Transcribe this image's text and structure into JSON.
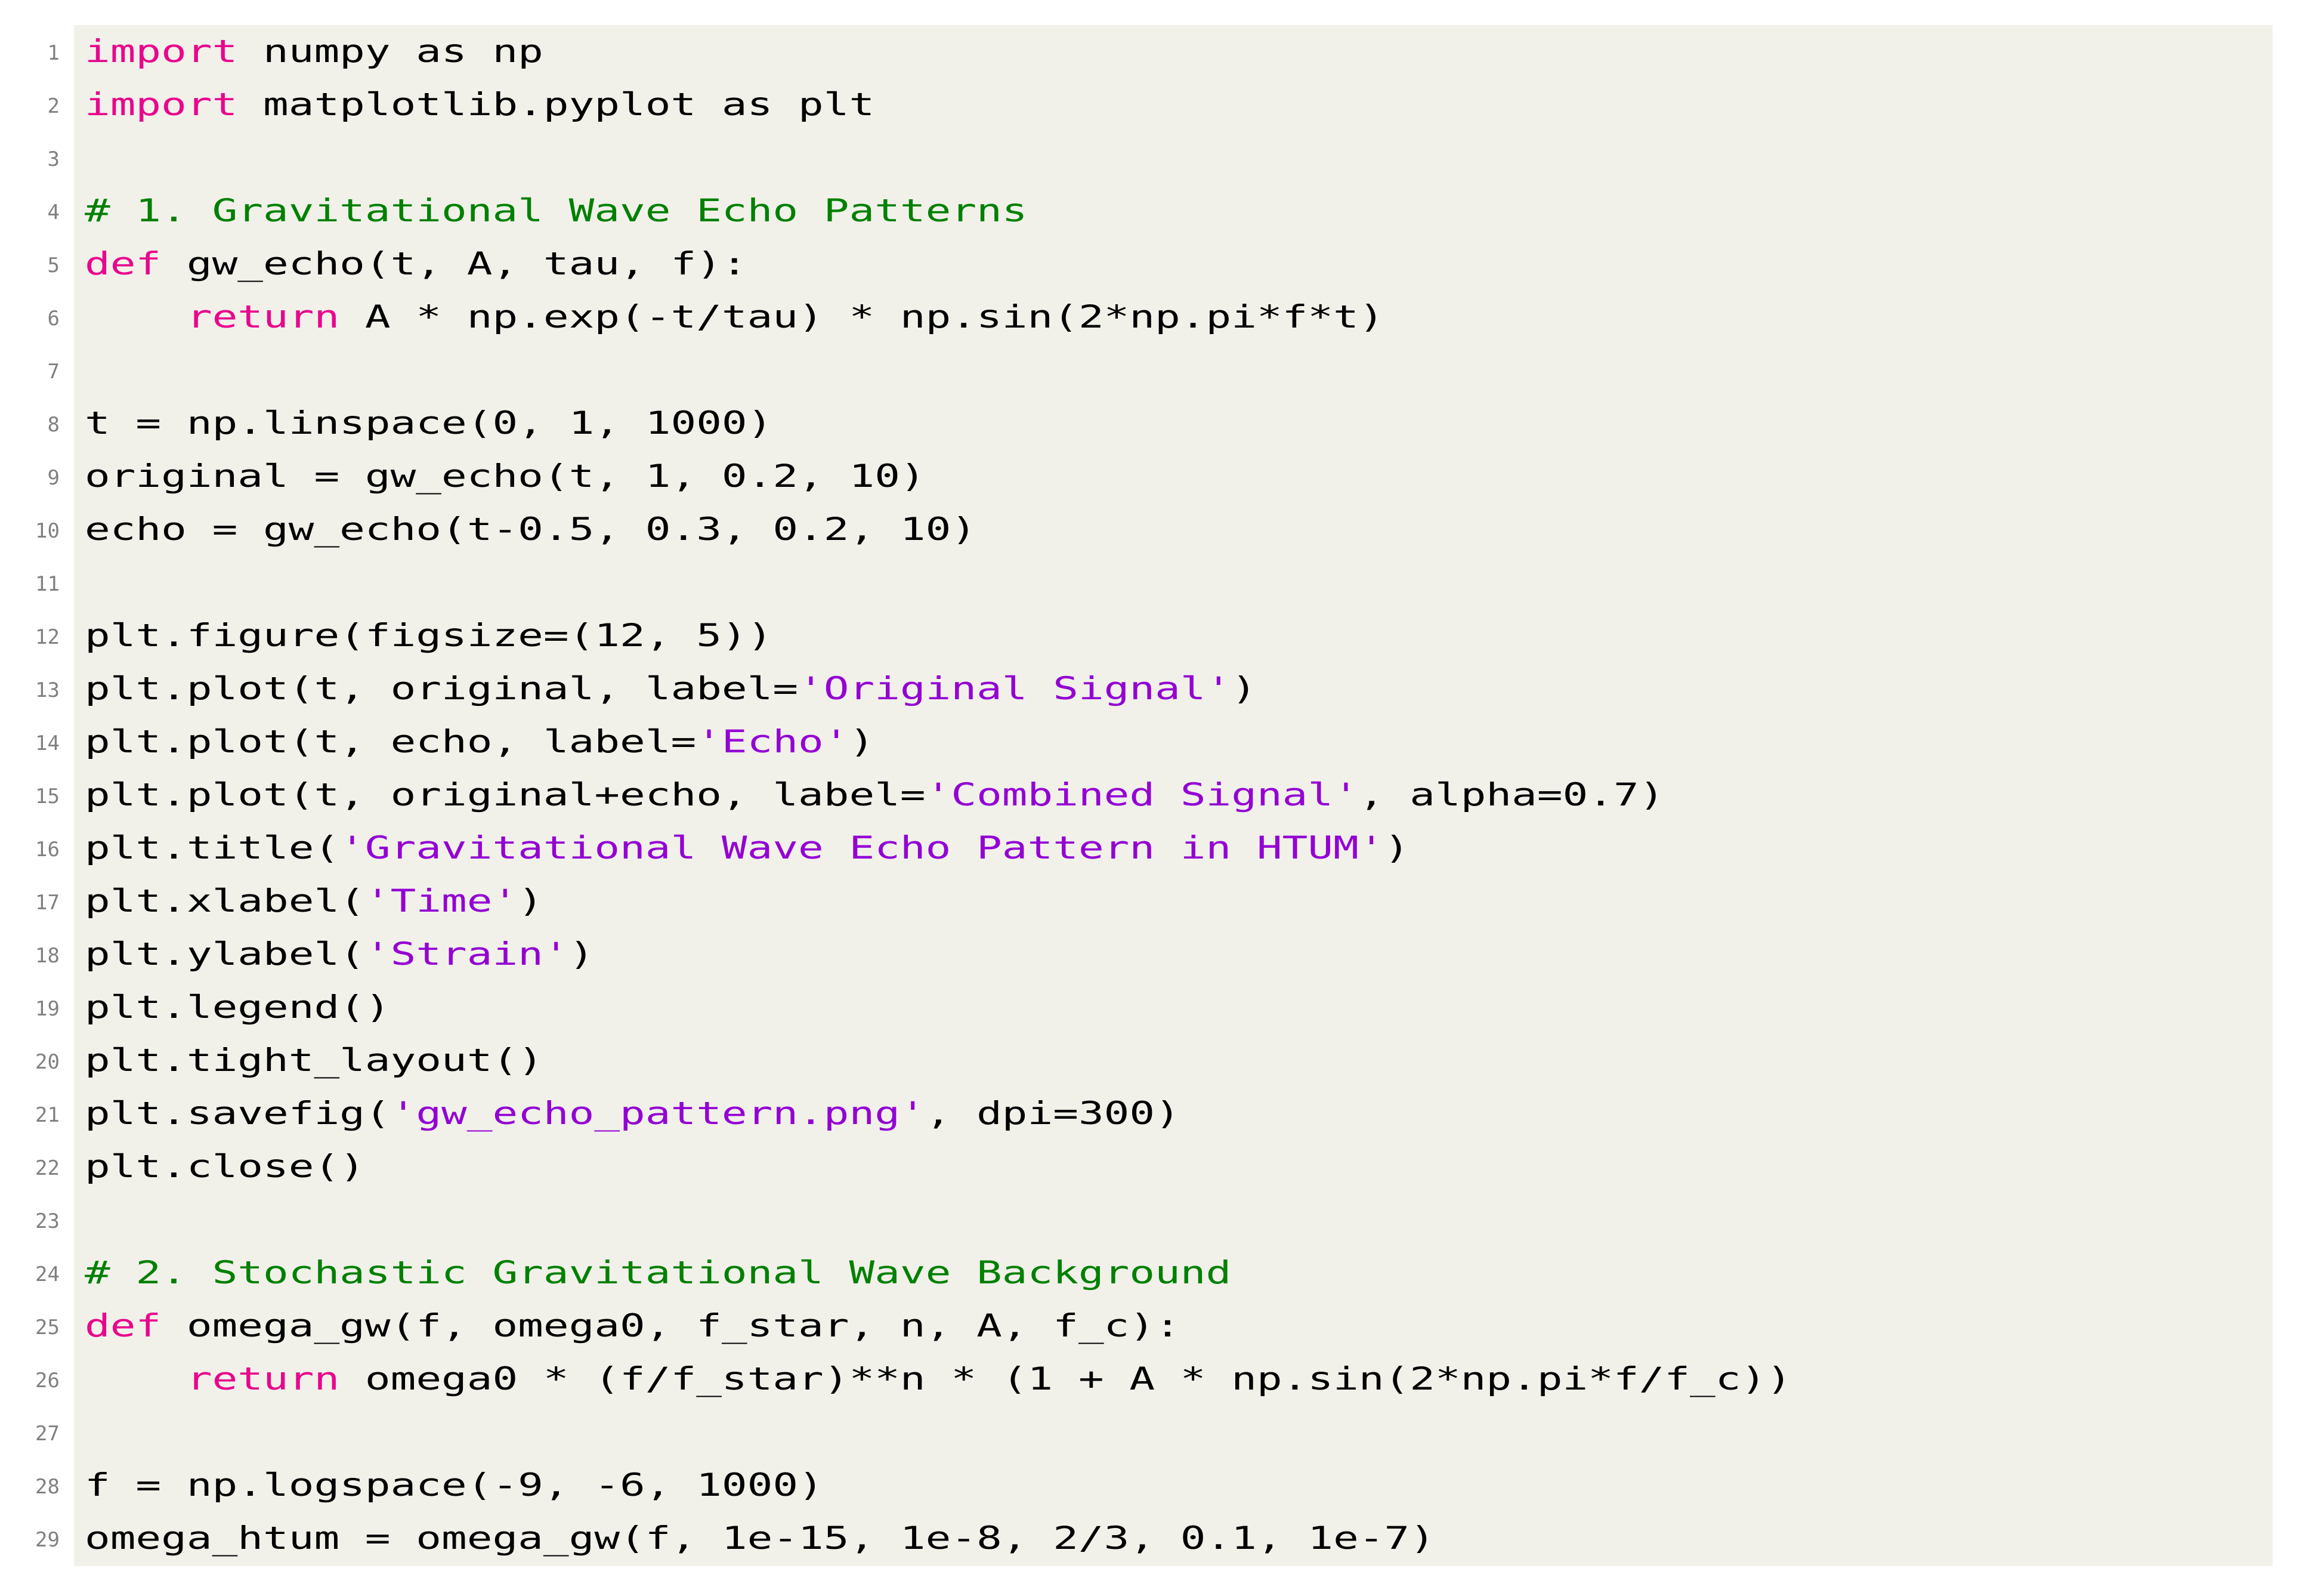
{
  "document": {
    "kind": "code-listing",
    "language": "Python",
    "line_count": 29
  },
  "colors": {
    "page_background": "#ffffff",
    "code_background": "#f1f1ea",
    "keyword": "#e8068c",
    "comment": "#008000",
    "string": "#9400d3",
    "plain_text": "#000000",
    "line_number": "#808080"
  },
  "code": {
    "lines": [
      {
        "number": "1",
        "text": "import numpy as np",
        "tokens": [
          {
            "t": "import",
            "c": "k"
          },
          {
            "t": " numpy as np",
            "c": "n"
          }
        ]
      },
      {
        "number": "2",
        "text": "import matplotlib.pyplot as plt",
        "tokens": [
          {
            "t": "import",
            "c": "k"
          },
          {
            "t": " matplotlib.pyplot as plt",
            "c": "n"
          }
        ]
      },
      {
        "number": "3",
        "text": "",
        "tokens": []
      },
      {
        "number": "4",
        "text": "# 1. Gravitational Wave Echo Patterns",
        "tokens": [
          {
            "t": "# 1. Gravitational Wave Echo Patterns",
            "c": "c"
          }
        ]
      },
      {
        "number": "5",
        "text": "def gw_echo(t, A, tau, f):",
        "tokens": [
          {
            "t": "def",
            "c": "k"
          },
          {
            "t": " gw_echo(t, A, tau, f):",
            "c": "n"
          }
        ]
      },
      {
        "number": "6",
        "text": "    return A * np.exp(-t/tau) * np.sin(2*np.pi*f*t)",
        "tokens": [
          {
            "t": "    ",
            "c": "n"
          },
          {
            "t": "return",
            "c": "k"
          },
          {
            "t": " A * np.exp(-t/tau) * np.sin(2*np.pi*f*t)",
            "c": "n"
          }
        ]
      },
      {
        "number": "7",
        "text": "",
        "tokens": []
      },
      {
        "number": "8",
        "text": "t = np.linspace(0, 1, 1000)",
        "tokens": [
          {
            "t": "t = np.linspace(0, 1, 1000)",
            "c": "n"
          }
        ]
      },
      {
        "number": "9",
        "text": "original = gw_echo(t, 1, 0.2, 10)",
        "tokens": [
          {
            "t": "original = gw_echo(t, 1, 0.2, 10)",
            "c": "n"
          }
        ]
      },
      {
        "number": "10",
        "text": "echo = gw_echo(t-0.5, 0.3, 0.2, 10)",
        "tokens": [
          {
            "t": "echo = gw_echo(t-0.5, 0.3, 0.2, 10)",
            "c": "n"
          }
        ]
      },
      {
        "number": "11",
        "text": "",
        "tokens": []
      },
      {
        "number": "12",
        "text": "plt.figure(figsize=(12, 5))",
        "tokens": [
          {
            "t": "plt.figure(figsize=(12, 5))",
            "c": "n"
          }
        ]
      },
      {
        "number": "13",
        "text": "plt.plot(t, original, label='Original Signal')",
        "tokens": [
          {
            "t": "plt.plot(t, original, label=",
            "c": "n"
          },
          {
            "t": "'Original Signal'",
            "c": "s"
          },
          {
            "t": ")",
            "c": "n"
          }
        ]
      },
      {
        "number": "14",
        "text": "plt.plot(t, echo, label='Echo')",
        "tokens": [
          {
            "t": "plt.plot(t, echo, label=",
            "c": "n"
          },
          {
            "t": "'Echo'",
            "c": "s"
          },
          {
            "t": ")",
            "c": "n"
          }
        ]
      },
      {
        "number": "15",
        "text": "plt.plot(t, original+echo, label='Combined Signal', alpha=0.7)",
        "tokens": [
          {
            "t": "plt.plot(t, original+echo, label=",
            "c": "n"
          },
          {
            "t": "'Combined Signal'",
            "c": "s"
          },
          {
            "t": ", alpha=0.7)",
            "c": "n"
          }
        ]
      },
      {
        "number": "16",
        "text": "plt.title('Gravitational Wave Echo Pattern in HTUM')",
        "tokens": [
          {
            "t": "plt.title(",
            "c": "n"
          },
          {
            "t": "'Gravitational Wave Echo Pattern in HTUM'",
            "c": "s"
          },
          {
            "t": ")",
            "c": "n"
          }
        ]
      },
      {
        "number": "17",
        "text": "plt.xlabel('Time')",
        "tokens": [
          {
            "t": "plt.xlabel(",
            "c": "n"
          },
          {
            "t": "'Time'",
            "c": "s"
          },
          {
            "t": ")",
            "c": "n"
          }
        ]
      },
      {
        "number": "18",
        "text": "plt.ylabel('Strain')",
        "tokens": [
          {
            "t": "plt.ylabel(",
            "c": "n"
          },
          {
            "t": "'Strain'",
            "c": "s"
          },
          {
            "t": ")",
            "c": "n"
          }
        ]
      },
      {
        "number": "19",
        "text": "plt.legend()",
        "tokens": [
          {
            "t": "plt.legend()",
            "c": "n"
          }
        ]
      },
      {
        "number": "20",
        "text": "plt.tight_layout()",
        "tokens": [
          {
            "t": "plt.tight_layout()",
            "c": "n"
          }
        ]
      },
      {
        "number": "21",
        "text": "plt.savefig('gw_echo_pattern.png', dpi=300)",
        "tokens": [
          {
            "t": "plt.savefig(",
            "c": "n"
          },
          {
            "t": "'gw_echo_pattern.png'",
            "c": "s"
          },
          {
            "t": ", dpi=300)",
            "c": "n"
          }
        ]
      },
      {
        "number": "22",
        "text": "plt.close()",
        "tokens": [
          {
            "t": "plt.close()",
            "c": "n"
          }
        ]
      },
      {
        "number": "23",
        "text": "",
        "tokens": []
      },
      {
        "number": "24",
        "text": "# 2. Stochastic Gravitational Wave Background",
        "tokens": [
          {
            "t": "# 2. Stochastic Gravitational Wave Background",
            "c": "c"
          }
        ]
      },
      {
        "number": "25",
        "text": "def omega_gw(f, omega0, f_star, n, A, f_c):",
        "tokens": [
          {
            "t": "def",
            "c": "k"
          },
          {
            "t": " omega_gw(f, omega0, f_star, n, A, f_c):",
            "c": "n"
          }
        ]
      },
      {
        "number": "26",
        "text": "    return omega0 * (f/f_star)**n * (1 + A * np.sin(2*np.pi*f/f_c))",
        "tokens": [
          {
            "t": "    ",
            "c": "n"
          },
          {
            "t": "return",
            "c": "k"
          },
          {
            "t": " omega0 * (f/f_star)**n * (1 + A * np.sin(2*np.pi*f/f_c))",
            "c": "n"
          }
        ]
      },
      {
        "number": "27",
        "text": "",
        "tokens": []
      },
      {
        "number": "28",
        "text": "f = np.logspace(-9, -6, 1000)",
        "tokens": [
          {
            "t": "f = np.logspace(-9, -6, 1000)",
            "c": "n"
          }
        ]
      },
      {
        "number": "29",
        "text": "omega_htum = omega_gw(f, 1e-15, 1e-8, 2/3, 0.1, 1e-7)",
        "tokens": [
          {
            "t": "omega_htum = omega_gw(f, 1e-15, 1e-8, 2/3, 0.1, 1e-7)",
            "c": "n"
          }
        ]
      }
    ]
  }
}
